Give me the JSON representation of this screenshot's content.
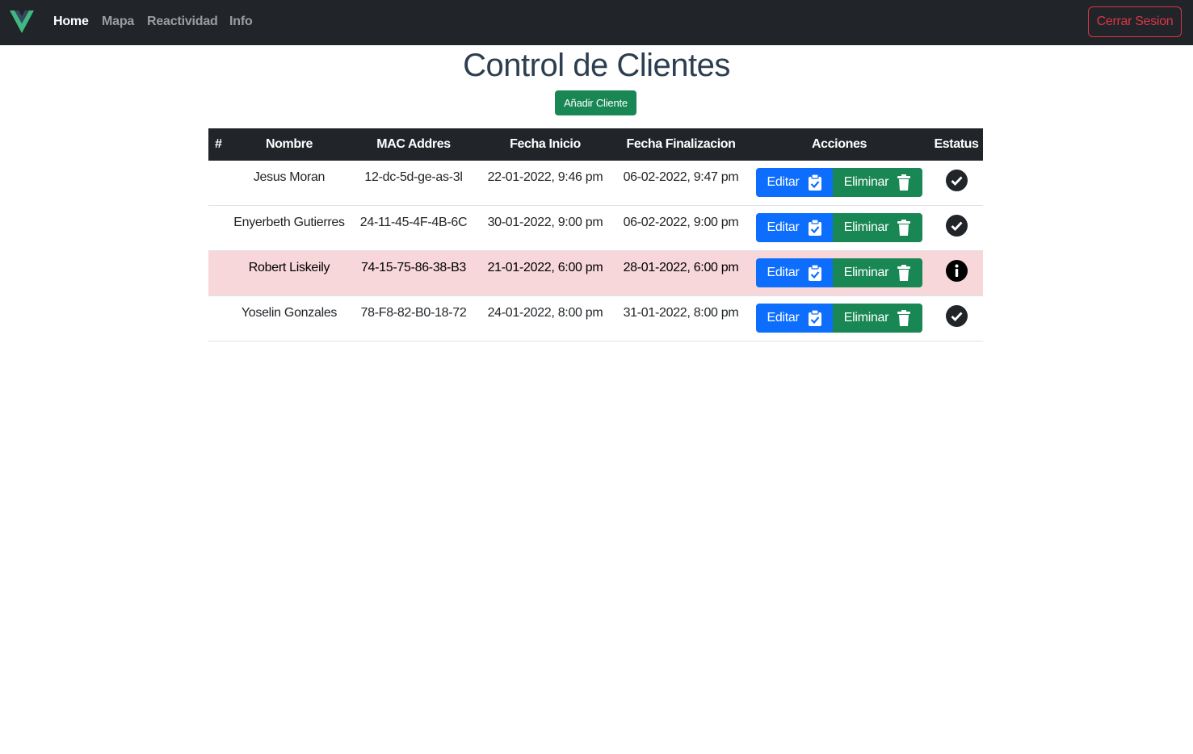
{
  "navbar": {
    "logo_icon": "vue-logo-icon",
    "links": [
      {
        "label": "Home",
        "active": true
      },
      {
        "label": "Mapa",
        "active": false
      },
      {
        "label": "Reactividad",
        "active": false
      },
      {
        "label": "Info",
        "active": false
      }
    ],
    "logout_label": "Cerrar Sesion"
  },
  "page": {
    "title": "Control de Clientes",
    "add_button_label": "Añadir Cliente"
  },
  "table": {
    "headers": [
      "#",
      "Nombre",
      "MAC Addres",
      "Fecha Inicio",
      "Fecha Finalizacion",
      "Acciones",
      "Estatus"
    ],
    "edit_label": "Editar",
    "delete_label": "Eliminar",
    "rows": [
      {
        "number": "",
        "name": "Jesus Moran",
        "mac": "12-dc-5d-ge-as-3l",
        "start": "22-01-2022, 9:46 pm",
        "end": "06-02-2022, 9:47 pm",
        "status_icon": "check-circle-icon",
        "highlight": false
      },
      {
        "number": "",
        "name": "Enyerbeth Gutierres",
        "mac": "24-11-45-4F-4B-6C",
        "start": "30-01-2022, 9:00 pm",
        "end": "06-02-2022, 9:00 pm",
        "status_icon": "check-circle-icon",
        "highlight": false
      },
      {
        "number": "",
        "name": "Robert Liskeily",
        "mac": "74-15-75-86-38-B3",
        "start": "21-01-2022, 6:00 pm",
        "end": "28-01-2022, 6:00 pm",
        "status_icon": "info-circle-icon",
        "highlight": true
      },
      {
        "number": "",
        "name": "Yoselin Gonzales",
        "mac": "78-F8-82-B0-18-72",
        "start": "24-01-2022, 8:00 pm",
        "end": "31-01-2022, 8:00 pm",
        "status_icon": "check-circle-icon",
        "highlight": false
      }
    ]
  },
  "colors": {
    "navbar_bg": "#212529",
    "primary": "#0d6efd",
    "success": "#198754",
    "danger": "#dc3545",
    "danger_row_bg": "#f8d7da",
    "title": "#2c3e50"
  }
}
